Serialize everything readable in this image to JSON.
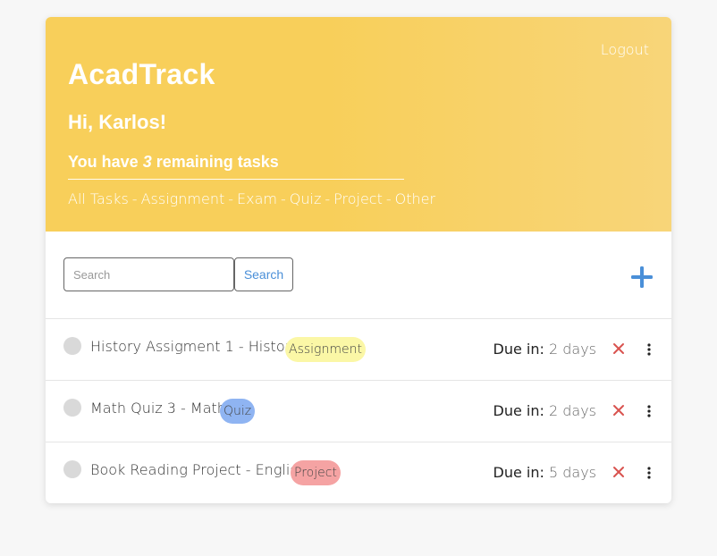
{
  "header": {
    "logout_label": "Logout",
    "app_title": "AcadTrack",
    "greeting": "Hi, Karlos!",
    "remaining_prefix": "You have",
    "remaining_count": "3",
    "remaining_suffix": "remaining tasks",
    "filters": [
      "All Tasks",
      "Assignment",
      "Exam",
      "Quiz",
      "Project",
      "Other"
    ],
    "filter_separator": "-"
  },
  "search": {
    "placeholder": "Search",
    "button_label": "Search",
    "add_icon": "plus-icon"
  },
  "tasks": [
    {
      "title": "History Assigment 1 - History",
      "tag": "Assignment",
      "due_label": "Due in:",
      "due_value": "2 days"
    },
    {
      "title": "Math Quiz 3 - Math",
      "tag": "Quiz",
      "due_label": "Due in:",
      "due_value": "2 days"
    },
    {
      "title": "Book Reading Project - English",
      "tag": "Project",
      "due_label": "Due in:",
      "due_value": "5 days"
    }
  ],
  "colors": {
    "header": "#f8cf5a",
    "tag_assignment": "#fbf7a6",
    "tag_quiz": "#8fb4f2",
    "tag_project": "#f5a3a3",
    "delete": "#d9534f",
    "accent": "#4a8fd8"
  }
}
